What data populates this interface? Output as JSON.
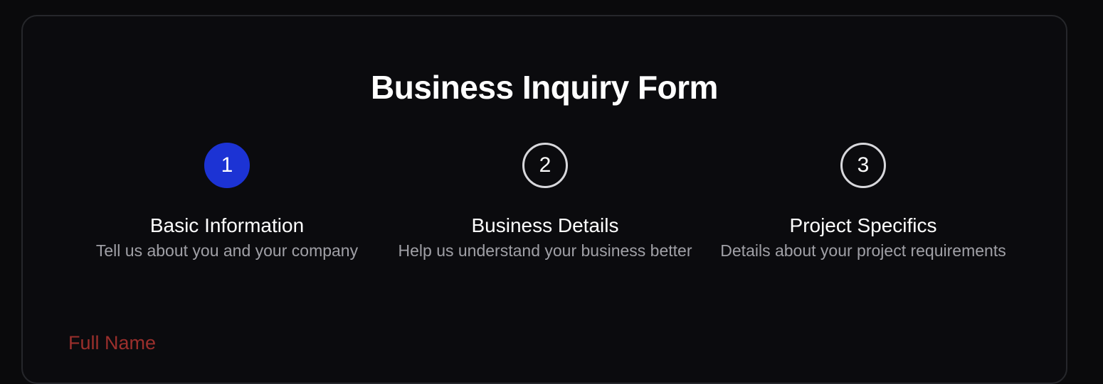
{
  "form": {
    "title": "Business Inquiry Form",
    "accent_color": "#1c33d4",
    "error_color": "#9b2f2c",
    "active_step": 1
  },
  "steps": [
    {
      "number": "1",
      "title": "Basic Information",
      "description": "Tell us about you and your company"
    },
    {
      "number": "2",
      "title": "Business Details",
      "description": "Help us understand your business better"
    },
    {
      "number": "3",
      "title": "Project Specifics",
      "description": "Details about your project requirements"
    }
  ],
  "fields": {
    "full_name_label": "Full Name"
  }
}
